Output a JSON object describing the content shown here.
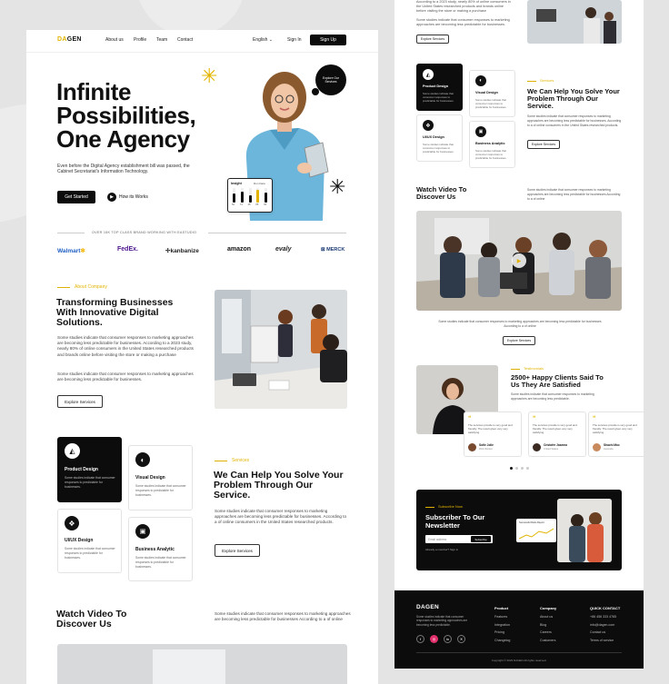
{
  "colors": {
    "accent": "#e2b400",
    "dark": "#0c0c0c",
    "bg": "#e4e4e4"
  },
  "nav": {
    "logo": "DAGEN",
    "links": [
      "About us",
      "Profile",
      "Team",
      "Contact"
    ],
    "language": "English",
    "signin": "Sign In",
    "signup": "Sign Up"
  },
  "hero": {
    "title_lines": [
      "Infinite",
      "Possibilities,",
      "One Agency"
    ],
    "desc": "Even before the Digital Agency establishment bill was passed, the Cabinet Secretariat's Information Technology.",
    "cta": "Get Started",
    "video": "How its Works",
    "bubble": "Explore Our Services",
    "insight_title": "Insight",
    "insight_sub": "Run Data",
    "insight_values": [
      60,
      78,
      48,
      90,
      70
    ],
    "insight_labels": [
      "56",
      "74",
      "45",
      "85",
      "65"
    ]
  },
  "brands": {
    "caption": "OVER 15K TOP CLASS BRAND WORKING WITH EASTUDIO",
    "items": [
      "Walmart",
      "FedEx.",
      "kanbanize",
      "amazon",
      "evaly",
      "MERCK"
    ]
  },
  "about": {
    "kicker": "About Company",
    "title": "Transforming Businesses With Innovative Digital Solutions.",
    "p1": "Some studies indicate that consumer responses to marketing approaches are becoming less predictable for businesses. According to a 2023 study, nearly 80% of online consumers in the United States researched products and brands online before visiting the store or making a purchase",
    "p2": "Some studies indicate that consumer responses to marketing approaches are becoming less predictable for businesses.",
    "btn": "Explore Services"
  },
  "services": {
    "kicker": "Services",
    "title": "We Can Help You Solve Your Problem Through Our Service.",
    "desc": "Some studies indicate that consumer responses to marketing approaches are becoming less predictable for businesses. According to a of online consumers in the United States researched products.",
    "btn": "Explore Services",
    "cards": [
      {
        "name": "Product Design",
        "desc": "Some studies indicate that consumer responses to predictable for businesses."
      },
      {
        "name": "Visual Design",
        "desc": "Some studies indicate that consumer responses to predictable for businesses."
      },
      {
        "name": "UI/UX Design",
        "desc": "Some studies indicate that consumer responses to predictable for businesses."
      },
      {
        "name": "Business Analytic",
        "desc": "Some studies indicate that consumer responses to predictable for businesses."
      }
    ]
  },
  "video": {
    "title": "Watch Video To Discover Us",
    "desc": "Some studies indicate that consumer responses to marketing approaches are becoming less predictable for businesses According to a of online",
    "caption": "Some studies indicate that consumer responses to marketing approaches are becoming less predictable for businesses According to a of online",
    "btn": "Explore Services"
  },
  "right_top": {
    "text": "According to a 2023 study, nearly 80% of online consumers in the United States researched products and brands online before visiting the store or making a purchase",
    "p2": "Some studies indicate that consumer responses to marketing approaches are becoming less predictable for businesses.",
    "btn": "Explore Services"
  },
  "testimonials": {
    "kicker": "Testimonials",
    "title": "2500+ Happy Clients Said To Us They Are Satisfied",
    "desc": "Some studies indicate that consumer responses to marketing approaches are becoming less predictable.",
    "items": [
      {
        "quote": "The services provide is very good and friendly. The result given very very satisfying.",
        "name": "Sofie Jolie",
        "role": "Web Worker"
      },
      {
        "quote": "The services provide is very good and friendly. The result given very very satisfying.",
        "name": "Cristofer Jasema",
        "role": "United States"
      },
      {
        "quote": "The services provide is very good and friendly. The result given very very satisfying.",
        "name": "Shachi Moc",
        "role": "Australia"
      }
    ]
  },
  "newsletter": {
    "kicker": "Subscribe Now",
    "title": "Subscriber To Our Newsletter",
    "placeholder": "Email address",
    "btn": "Subscribe",
    "note": "Already a member? Sign in",
    "chart_label": "Successful Ratio Report"
  },
  "footer": {
    "logo": "DAGEN",
    "desc": "Some studies indicate that consumer responses to marketing approaches are becoming less predictable.",
    "cols": [
      {
        "title": "Product",
        "links": [
          "Features",
          "Integration",
          "Pricing",
          "Changelog"
        ]
      },
      {
        "title": "Company",
        "links": [
          "About us",
          "Blog",
          "Careers",
          "Customers"
        ]
      },
      {
        "title": "QUICK CONTACT",
        "links": [
          "+86 456 333 4785",
          "info@dagen.com",
          "Contact us",
          "Terms of service"
        ]
      }
    ],
    "copyright": "Copyright © 2023 DAGEN All rights reserved."
  }
}
